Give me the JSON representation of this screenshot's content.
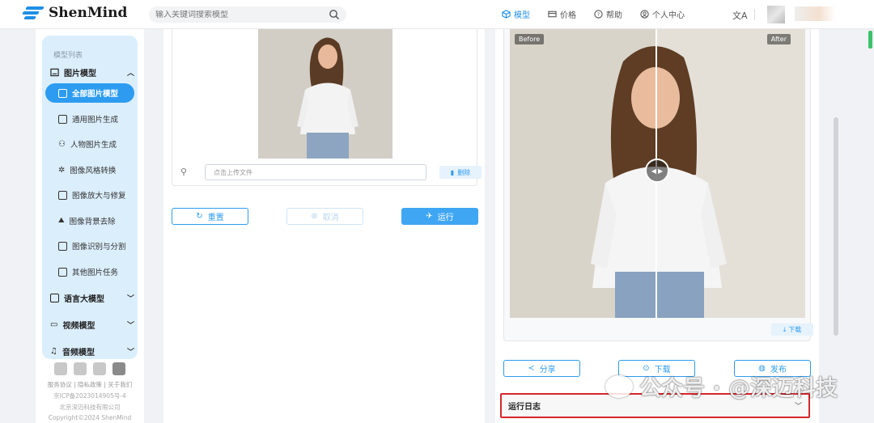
{
  "header": {
    "logo_text": "ShenMind",
    "search_placeholder": "输入关键词搜索模型",
    "nav": [
      {
        "label": "模型",
        "icon": "cube-icon",
        "active": true
      },
      {
        "label": "价格",
        "icon": "card-icon",
        "active": false
      },
      {
        "label": "帮助",
        "icon": "help-circle-icon",
        "active": false
      },
      {
        "label": "个人中心",
        "icon": "user-circle-icon",
        "active": false
      }
    ],
    "language_icon": "translate-icon"
  },
  "sidebar": {
    "title": "模型列表",
    "groups": [
      {
        "label": "图片模型",
        "chevron": "up"
      },
      {
        "label": "语言大模型",
        "chevron": "down"
      },
      {
        "label": "视频模型",
        "chevron": "down"
      },
      {
        "label": "音频模型",
        "chevron": "down"
      }
    ],
    "items": [
      {
        "label": "全部图片模型",
        "active": true
      },
      {
        "label": "通用图片生成",
        "active": false
      },
      {
        "label": "人物图片生成",
        "active": false
      },
      {
        "label": "图像风格转换",
        "active": false
      },
      {
        "label": "图像放大与修复",
        "active": false
      },
      {
        "label": "图像背景去除",
        "active": false
      },
      {
        "label": "图像识别与分割",
        "active": false
      },
      {
        "label": "其他图片任务",
        "active": false
      }
    ],
    "footer": {
      "links": "服务协议 | 隐私政策 | 关于我们",
      "icp": "京ICP备2023014905号-4",
      "company": "北京深迈科技有限公司",
      "copyright": "Copyright©2024 ShenMind"
    }
  },
  "left_panel": {
    "file_placeholder": "点击上传文件",
    "delete_label": "删除",
    "reset_label": "重置",
    "cancel_label": "取消",
    "run_label": "运行"
  },
  "right_panel": {
    "before_label": "Before",
    "after_label": "After",
    "download_small": "下载",
    "share_label": "分享",
    "download_label": "下载",
    "publish_label": "发布",
    "log_label": "运行日志"
  },
  "watermark": "公众号 · @深迈科技",
  "colors": {
    "accent": "#2d9cf0",
    "sidebar_bg": "#dbeefc",
    "log_border": "#d9262c"
  }
}
